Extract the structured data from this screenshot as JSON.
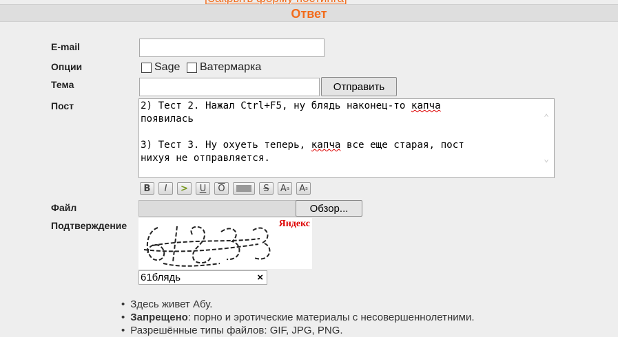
{
  "header": {
    "close_form_link": "[Закрыть форму постинга]",
    "title": "Ответ"
  },
  "form": {
    "email_label": "E-mail",
    "email_value": "",
    "options_label": "Опции",
    "option_sage": "Sage",
    "option_watermark": "Ватермарка",
    "subject_label": "Тема",
    "subject_value": "",
    "submit_label": "Отправить",
    "post_label": "Пост",
    "post_lines": [
      [
        "2) Тест 2. Нажал Ctrl+F5, ну блядь наконец-то ",
        "капча",
        ""
      ],
      [
        "появилась",
        "",
        ""
      ],
      [
        "",
        "",
        ""
      ],
      [
        "3) Тест 3. Ну охуеть теперь, ",
        "капча",
        " все еще старая, пост"
      ],
      [
        "нихуя не отправляется.",
        "",
        ""
      ]
    ],
    "file_label": "Файл",
    "browse_label": "Обзор...",
    "captcha_label": "Подтверждение",
    "captcha_brand": "Яндекс",
    "captcha_value": "61блядь",
    "clear_icon": "×"
  },
  "toolbar": {
    "buttons": [
      "bold-icon",
      "italic-icon",
      "quote-icon",
      "underline-icon",
      "overline-icon",
      "spoiler-icon",
      "strike-icon",
      "superscript-icon",
      "subscript-icon"
    ],
    "bold": "B",
    "italic": "I",
    "quote": ">",
    "underline": "U",
    "overline": "O",
    "strike": "S",
    "sup": "A",
    "sub": "A"
  },
  "rules": {
    "line1": "Здесь живет Абу.",
    "line2_bold": "Запрещено",
    "line2_rest": ": порно и эротические материалы с несовершеннолетними.",
    "line3": "Разрешённые типы файлов: GIF, JPG, PNG."
  },
  "colors": {
    "accent": "#f26c1c",
    "background": "#eeeeee"
  }
}
